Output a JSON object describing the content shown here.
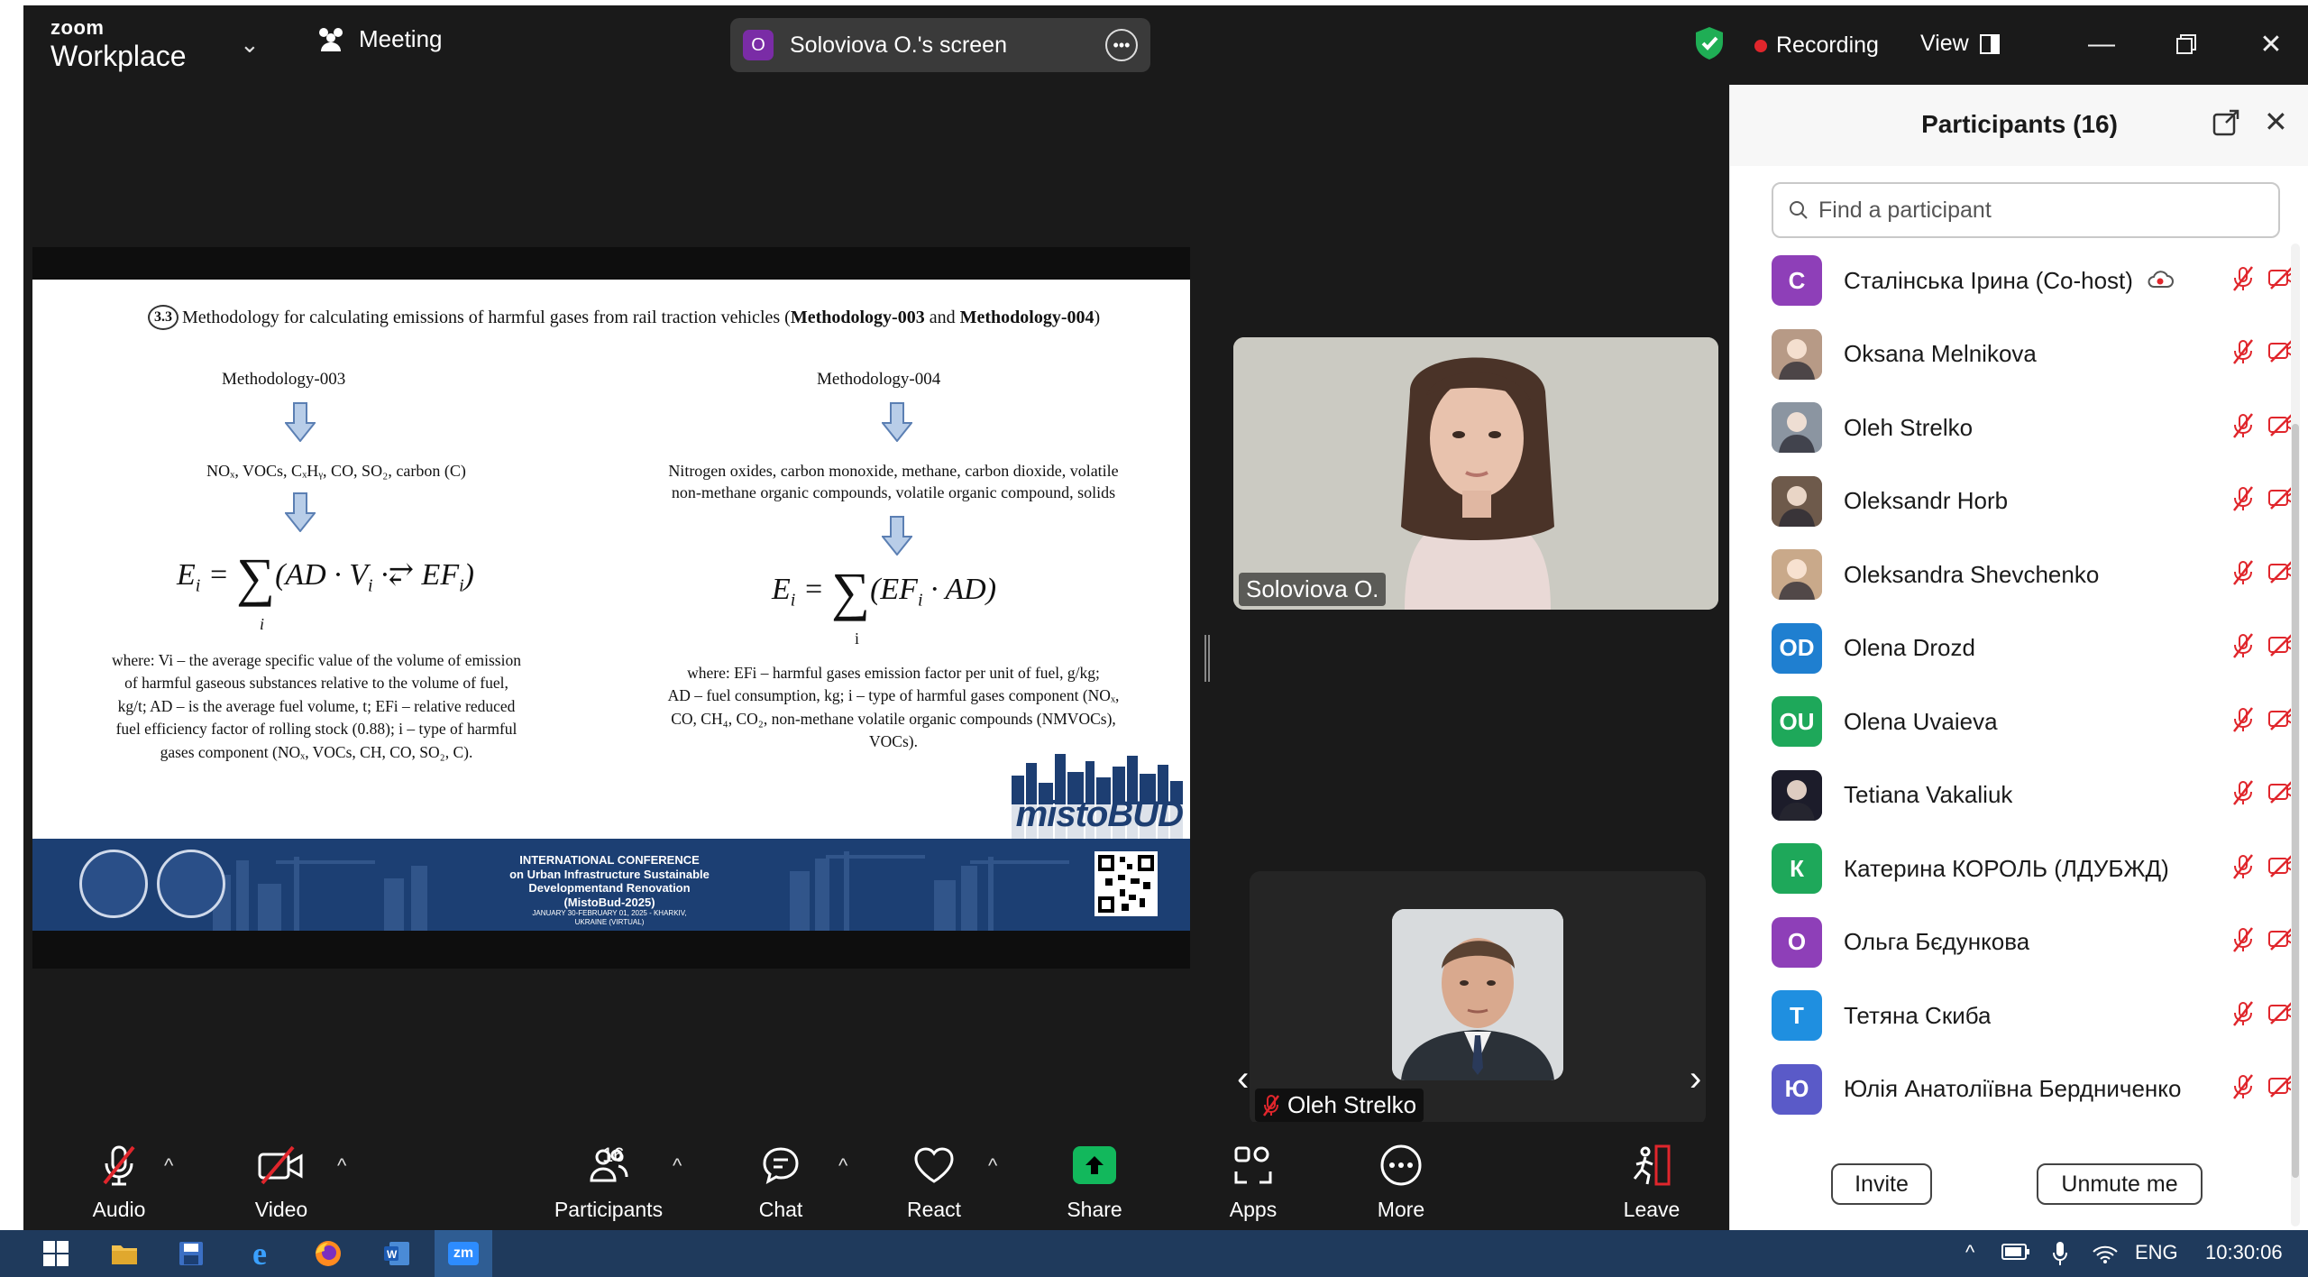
{
  "titlebar": {
    "brand_top": "zoom",
    "brand_bottom": "Workplace",
    "meeting_label": "Meeting",
    "screen_avatar": "O",
    "screen_title": "Soloviova O.'s screen",
    "recording_label": "Recording",
    "view_label": "View"
  },
  "slide": {
    "section_number": "3.3",
    "title_plain": "Methodology for calculating emissions of harmful gases from rail traction vehicles (",
    "title_bold_1": "Methodology-003",
    "title_and": " and ",
    "title_bold_2": "Methodology-004",
    "title_end": ")",
    "left": {
      "heading": "Methodology-003",
      "gases": "NOₓ, VOCs, CₓHᵧ, CO, SO₂, carbon (C)",
      "where_1": "where: Vi – the average specific value of the volume of emission",
      "where_2": "of harmful gaseous substances relative to the volume of fuel,",
      "where_3": "kg/t; AD – is the average fuel volume, t; EFi – relative reduced",
      "where_4": "fuel efficiency factor of rolling stock (0.88); i – type of harmful",
      "where_5": "gases component (NOₓ, VOCs, CH, CO, SO₂, C)."
    },
    "right": {
      "heading": "Methodology-004",
      "gases_1": "Nitrogen oxides, carbon monoxide, methane, carbon dioxide, volatile",
      "gases_2": "non-methane organic compounds, volatile organic compound, solids",
      "where_1": "where: EFi – harmful gases emission factor per unit of fuel, g/kg;",
      "where_2": "AD – fuel consumption, kg; i – type of harmful gases component (NOₓ,",
      "where_3": "CO, CH₄, CO₂, non-methane volatile organic compounds (NMVOCs),",
      "where_4": "VOCs)."
    },
    "logo_text": "mistoBUD",
    "banner": {
      "line1": "INTERNATIONAL CONFERENCE",
      "line2": "on Urban Infrastructure Sustainable",
      "line3": "Developmentand Renovation",
      "line4": "(MistoBud-2025)",
      "line5": "JANUARY 30-FEBRUARY 01, 2025 - KHARKIV,",
      "line6": "UKRAINE (VIRTUAL)"
    }
  },
  "videos": {
    "main_name": "Soloviova O.",
    "second_name": "Oleh Strelko"
  },
  "panel": {
    "title": "Participants (16)",
    "search_placeholder": "Find a participant",
    "invite_label": "Invite",
    "unmute_label": "Unmute me",
    "participants": [
      {
        "initials": "С",
        "name": "Сталінська Ірина (Co-host)",
        "color": "#8e3fb8"
      },
      {
        "initials": "",
        "name": "Oksana Melnikova",
        "color": "#b79a86"
      },
      {
        "initials": "",
        "name": "Oleh Strelko",
        "color": "#8b95a1"
      },
      {
        "initials": "",
        "name": "Oleksandr Horb",
        "color": "#6e5a4b"
      },
      {
        "initials": "",
        "name": "Oleksandra Shevchenko",
        "color": "#c9a98a"
      },
      {
        "initials": "OD",
        "name": "Olena Drozd",
        "color": "#1f7fd0"
      },
      {
        "initials": "OU",
        "name": "Olena Uvaieva",
        "color": "#1ea85a"
      },
      {
        "initials": "",
        "name": "Tetiana Vakaliuk",
        "color": "#1c1c2a"
      },
      {
        "initials": "К",
        "name": "Катерина КОРОЛЬ (ЛДУБЖД)",
        "color": "#1ea85a"
      },
      {
        "initials": "О",
        "name": "Ольга Бєдункова",
        "color": "#8e3fb8"
      },
      {
        "initials": "Т",
        "name": "Тетяна Скиба",
        "color": "#1f8fe0"
      },
      {
        "initials": "Ю",
        "name": "Юлія Анатоліївна Бердниченко",
        "color": "#5a5ac8"
      }
    ]
  },
  "controls": {
    "audio": "Audio",
    "video": "Video",
    "participants": "Participants",
    "participants_count": "16",
    "chat": "Chat",
    "react": "React",
    "share": "Share",
    "apps": "Apps",
    "more": "More",
    "leave": "Leave"
  },
  "taskbar": {
    "zoom_app": "zm",
    "language": "ENG",
    "time": "10:30:06"
  },
  "colors": {
    "chrome_dark": "#1a1a1a",
    "share_green": "#12b85c",
    "mute_red": "#e0262c",
    "banner_blue": "#1c3f73",
    "taskbar_blue": "#1f3a5c"
  }
}
